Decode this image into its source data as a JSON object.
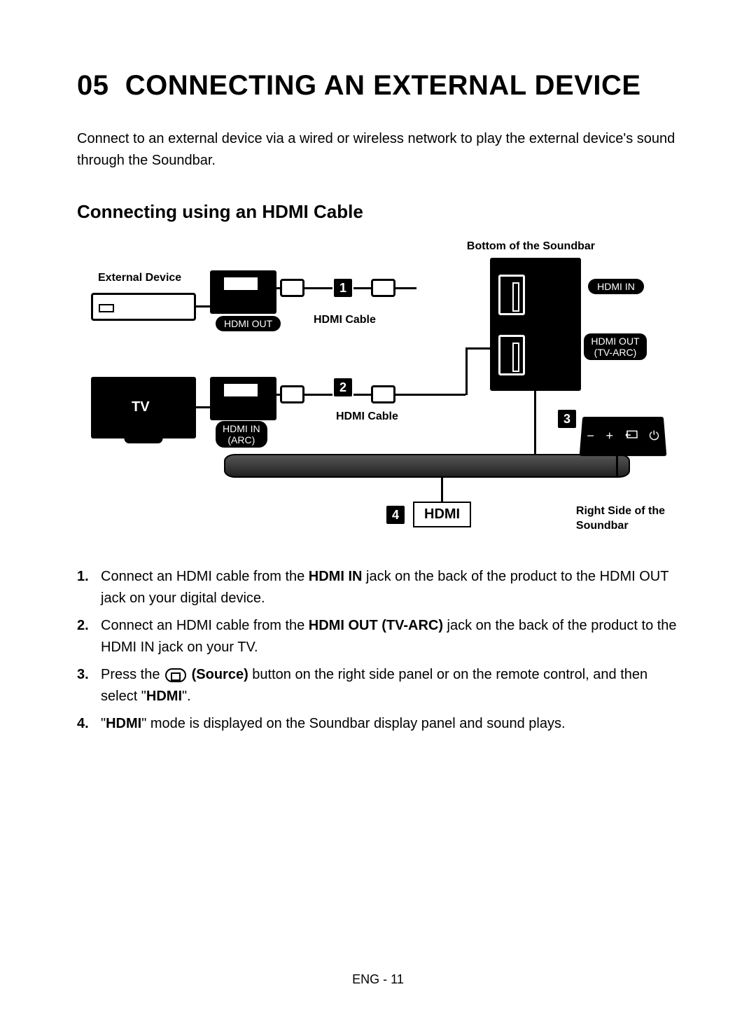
{
  "section_number": "05",
  "section_title": "CONNECTING AN EXTERNAL DEVICE",
  "intro": "Connect to an external device via a wired or wireless network to play the external device's sound through the Soundbar.",
  "subheading": "Connecting using an HDMI Cable",
  "diagram": {
    "external_device_label": "External Device",
    "hdmi_out_badge": "HDMI OUT",
    "hdmi_cable_label_1": "HDMI Cable",
    "hdmi_cable_label_2": "HDMI Cable",
    "tv_label": "TV",
    "hdmi_in_arc_badge_line1": "HDMI IN",
    "hdmi_in_arc_badge_line2": "(ARC)",
    "bottom_soundbar_label": "Bottom of the Soundbar",
    "hdmi_in_port": "HDMI IN",
    "hdmi_out_tvarc_line1": "HDMI OUT",
    "hdmi_out_tvarc_line2": "(TV-ARC)",
    "callout_1": "1",
    "callout_2": "2",
    "callout_3": "3",
    "callout_4": "4",
    "hdmi_display": "HDMI",
    "right_side_label_line1": "Right Side of the",
    "right_side_label_line2": "Soundbar",
    "side_panel_minus": "−",
    "side_panel_plus": "+",
    "side_panel_power": "⏻"
  },
  "steps": {
    "s1_pre": "Connect an HDMI cable from the ",
    "s1_bold": "HDMI IN",
    "s1_post": " jack on the back of the product to the HDMI OUT jack on your digital device.",
    "s2_pre": "Connect an HDMI cable from the ",
    "s2_bold": "HDMI OUT (TV-ARC)",
    "s2_post": " jack on the back of the product to the HDMI IN jack on your TV.",
    "s3_pre": "Press the ",
    "s3_bold1": "(Source)",
    "s3_mid": " button on the right side panel or on the remote control, and then select \"",
    "s3_bold2": "HDMI",
    "s3_post": "\".",
    "s4_pre": "\"",
    "s4_bold": "HDMI",
    "s4_post": "\" mode is displayed on the Soundbar display panel and sound plays."
  },
  "page_number": "ENG - 11"
}
